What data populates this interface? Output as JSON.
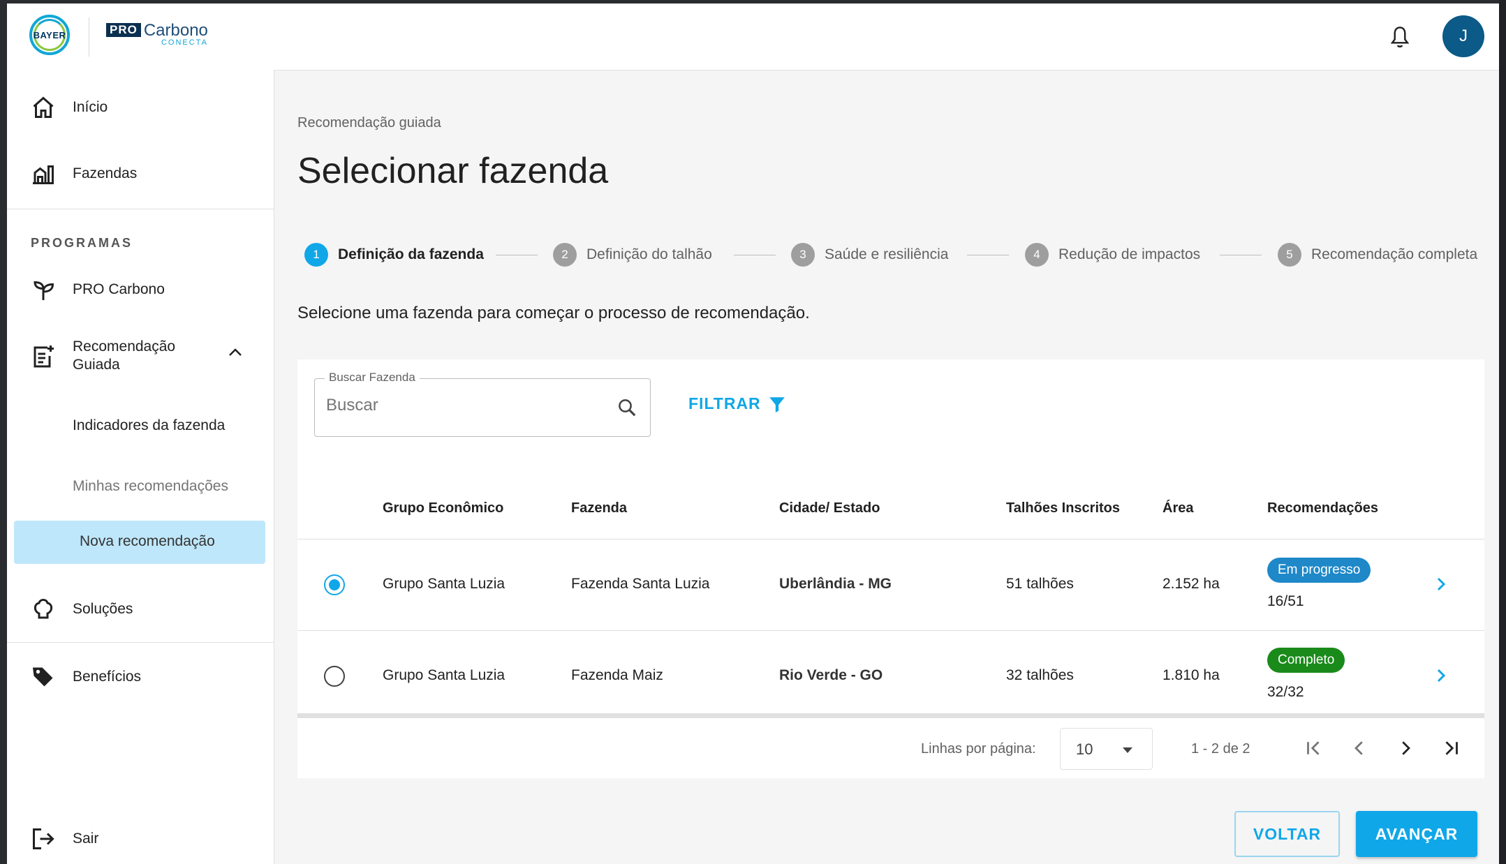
{
  "header": {
    "bayer_logo_text": "BAYER",
    "pro_logo": {
      "pro": "PRO",
      "carbono": "Carbono",
      "conecta": "CONECTA"
    },
    "avatar_initial": "J"
  },
  "sidebar": {
    "items": [
      {
        "label": "Início",
        "icon": "home-icon"
      },
      {
        "label": "Fazendas",
        "icon": "farm-icon"
      }
    ],
    "section_title": "PROGRAMAS",
    "programs": [
      {
        "label": "PRO Carbono",
        "icon": "sprout-icon"
      },
      {
        "label": "Recomendação Guiada",
        "icon": "clipboard-add-icon",
        "expanded": true
      }
    ],
    "sub_items": [
      {
        "label": "Indicadores da fazenda"
      },
      {
        "label": "Minhas recomendações"
      },
      {
        "label": "Nova recomendação",
        "active": true
      }
    ],
    "bottom_items": [
      {
        "label": "Soluções",
        "icon": "solutions-icon"
      },
      {
        "label": "Benefícios",
        "icon": "tag-icon"
      },
      {
        "label": "Sair",
        "icon": "logout-icon"
      }
    ]
  },
  "main": {
    "breadcrumb": "Recomendação guiada",
    "title": "Selecionar fazenda",
    "steps": [
      {
        "num": "1",
        "label": "Definição da fazenda",
        "active": true
      },
      {
        "num": "2",
        "label": "Definição do talhão"
      },
      {
        "num": "3",
        "label": "Saúde e resiliência"
      },
      {
        "num": "4",
        "label": "Redução de impactos"
      },
      {
        "num": "5",
        "label": "Recomendação completa"
      }
    ],
    "instruction": "Selecione uma fazenda para começar o processo de recomendação.",
    "search": {
      "label": "Buscar Fazenda",
      "placeholder": "Buscar"
    },
    "filter_label": "FILTRAR",
    "table": {
      "columns": [
        "Grupo Econômico",
        "Fazenda",
        "Cidade/ Estado",
        "Talhões Inscritos",
        "Área",
        "Recomendações"
      ],
      "rows": [
        {
          "selected": true,
          "grupo": "Grupo Santa Luzia",
          "fazenda": "Fazenda Santa Luzia",
          "cidade": "Uberlândia - MG",
          "talhoes": "51 talhões",
          "area": "2.152 ha",
          "status": "Em progresso",
          "progress": "16/51"
        },
        {
          "selected": false,
          "grupo": "Grupo Santa Luzia",
          "fazenda": "Fazenda Maiz",
          "cidade": "Rio Verde - GO",
          "talhoes": "32 talhões",
          "area": "1.810 ha",
          "status": "Completo",
          "progress": "32/32"
        }
      ]
    },
    "pagination": {
      "rows_label": "Linhas por página:",
      "rows_value": "10",
      "range": "1 - 2 de 2"
    },
    "buttons": {
      "back": "VOLTAR",
      "next": "AVANÇAR"
    }
  },
  "colors": {
    "accent": "#10a7e8",
    "in_progress": "#1e88c8",
    "complete": "#1a8a1a",
    "active_nav_bg": "#bfe7fb"
  }
}
